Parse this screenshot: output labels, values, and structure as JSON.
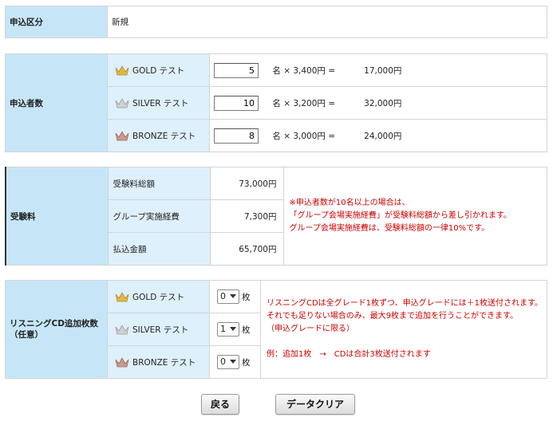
{
  "application_type": {
    "label": "申込区分",
    "value": "新規"
  },
  "applicants": {
    "label": "申込者数",
    "rows": [
      {
        "grade": "GOLD テスト",
        "icon": "gold-crown-icon",
        "color": "#e0b84a",
        "quantity": "5",
        "unit": "名",
        "times": "×",
        "price": "3,400円",
        "equals": "=",
        "total": "17,000円"
      },
      {
        "grade": "SILVER テスト",
        "icon": "silver-crown-icon",
        "color": "#c9c9c9",
        "quantity": "10",
        "unit": "名",
        "times": "×",
        "price": "3,200円",
        "equals": "=",
        "total": "32,000円"
      },
      {
        "grade": "BRONZE テスト",
        "icon": "bronze-crown-icon",
        "color": "#c99a8a",
        "quantity": "8",
        "unit": "名",
        "times": "×",
        "price": "3,000円",
        "equals": "=",
        "total": "24,000円"
      }
    ]
  },
  "fees": {
    "label": "受験料",
    "rows": [
      {
        "label": "受験料総額",
        "value": "73,000円"
      },
      {
        "label": "グループ実施経費",
        "value": "7,300円"
      },
      {
        "label": "払込金額",
        "value": "65,700円"
      }
    ],
    "notes": [
      "※申込者数が10名以上の場合は、",
      "「グループ会場実施経費」が受験料総額から差し引かれます。",
      "グループ会場実施経費は、受験料総額の一律10%です。"
    ]
  },
  "listening_cd": {
    "label_line1": "リスニングCD追加枚数",
    "label_line2": "（任意）",
    "unit": "枚",
    "rows": [
      {
        "grade": "GOLD テスト",
        "icon": "gold-crown-icon",
        "color": "#e0b84a",
        "selected": "0"
      },
      {
        "grade": "SILVER テスト",
        "icon": "silver-crown-icon",
        "color": "#c9c9c9",
        "selected": "1"
      },
      {
        "grade": "BRONZE テスト",
        "icon": "bronze-crown-icon",
        "color": "#c99a8a",
        "selected": "0"
      }
    ],
    "notes": [
      "リスニングCDは全グレード1枚ずつ、申込グレードには＋1枚送付されます。",
      "それでも足りない場合のみ、最大9枚まで追加を行うことができます。",
      "（申込グレードに限る）"
    ],
    "example": "例：追加1枚　→　CDは合計3枚送付されます"
  },
  "buttons": {
    "back": "戻る",
    "clear": "データクリア"
  },
  "colors": {
    "header_bg": "#c6e6f8",
    "sub_bg": "#def0fb",
    "note_red": "#cc0000"
  }
}
